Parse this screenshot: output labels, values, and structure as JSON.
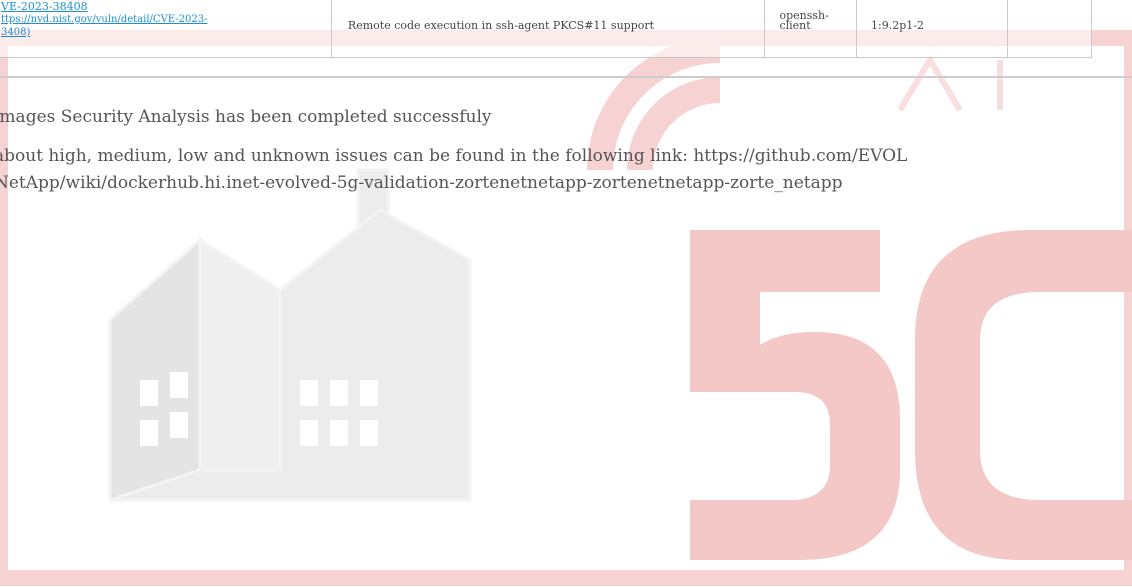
{
  "table": {
    "row": {
      "cve_id": "VE-2023-38408",
      "cve_url_line1": "ttps://nvd.nist.gov/vuln/detail/CVE-2023-",
      "cve_url_line2": "3408)",
      "description": "Remote code execution in ssh-agent PKCS#11 support",
      "package_line1": "openssh-",
      "package_line2": "client",
      "version": "1:9.2p1-2"
    }
  },
  "messages": {
    "line1": "images Security Analysis has been completed successfuly",
    "line2": "about high, medium, low and unknown issues can be found in the following link: https://github.com/EVOL",
    "line3": "NetApp/wiki/dockerhub.hi.inet-evolved-5g-validation-zortenetnetapp-zortenetnetapp-zorte_netapp"
  },
  "colors": {
    "watermark_red": "#f4c4c4",
    "watermark_grey": "#ececec",
    "link": "#1a8fd6",
    "text": "#555555"
  }
}
